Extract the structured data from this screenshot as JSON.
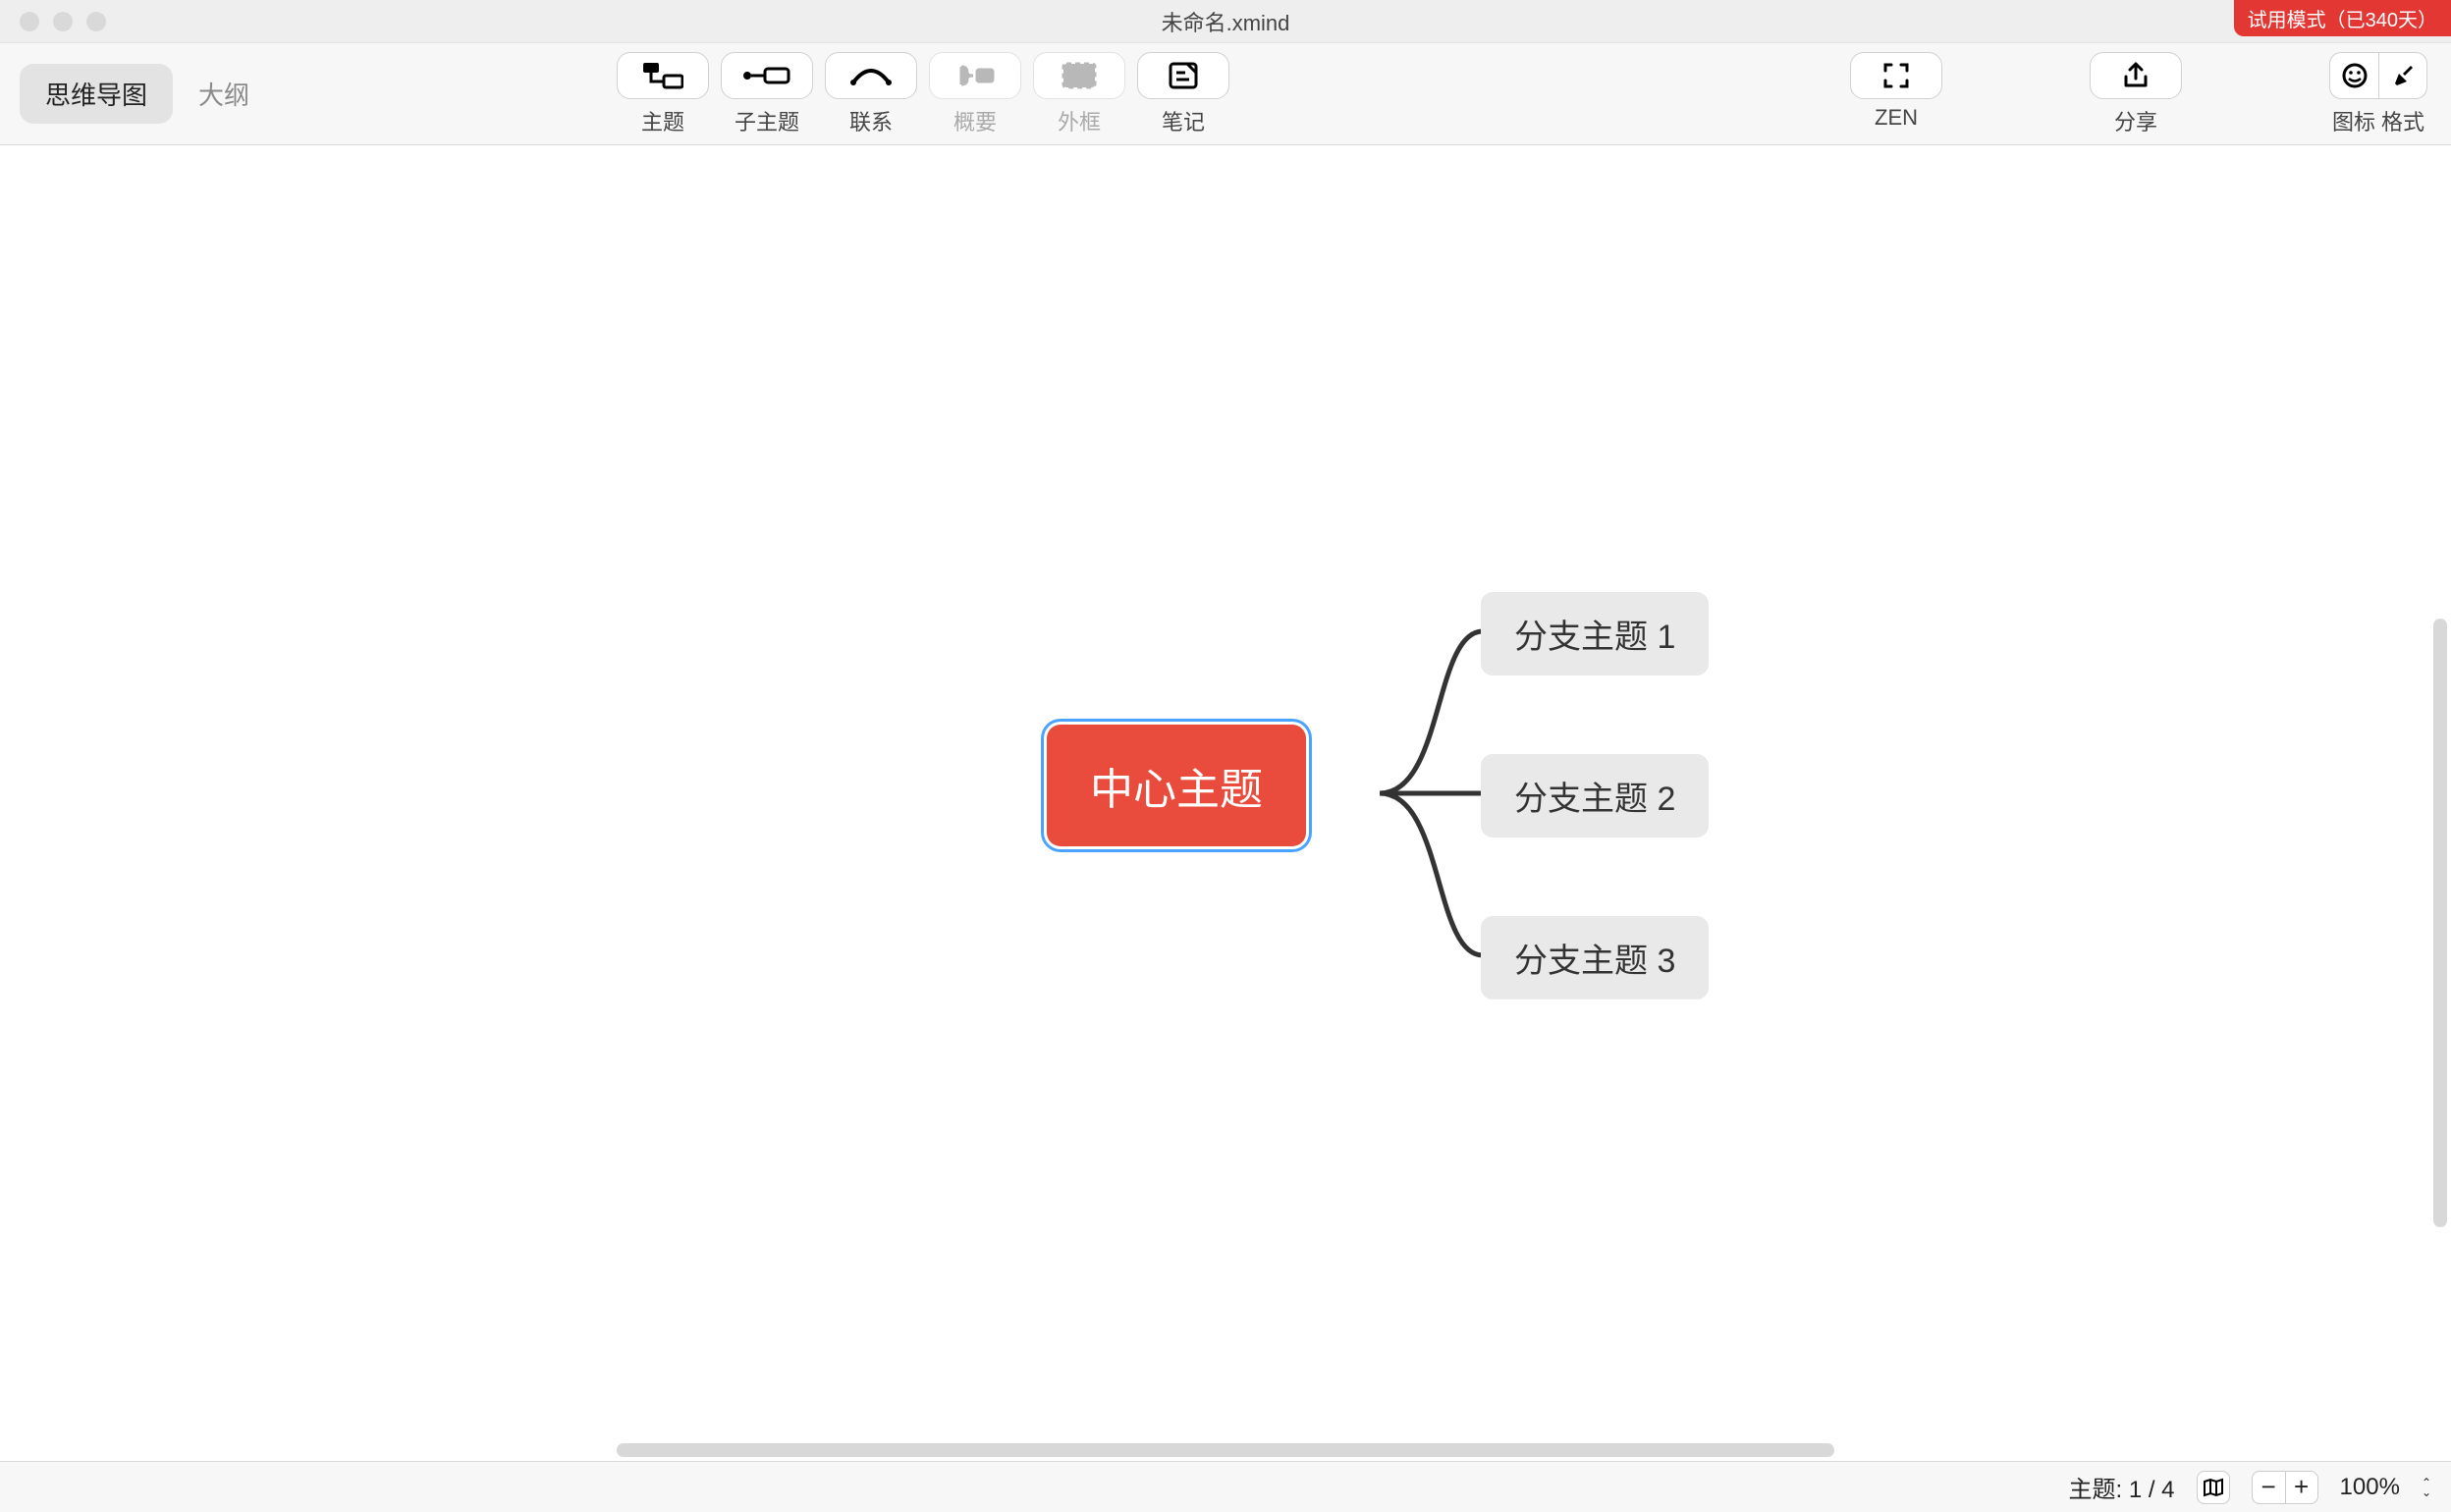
{
  "window": {
    "title": "未命名.xmind"
  },
  "trial": {
    "label": "试用模式（已340天）"
  },
  "viewToggle": {
    "mindmap": "思维导图",
    "outline": "大纲"
  },
  "tools": {
    "topic": "主题",
    "subtopic": "子主题",
    "relationship": "联系",
    "summary": "概要",
    "boundary": "外框",
    "note": "笔记",
    "zen": "ZEN",
    "share": "分享",
    "iconset": "图标",
    "format": "格式"
  },
  "mindmap": {
    "central": "中心主题",
    "branches": [
      "分支主题 1",
      "分支主题 2",
      "分支主题 3"
    ]
  },
  "status": {
    "topicCount": "主题: 1 / 4",
    "zoom": "100%"
  }
}
